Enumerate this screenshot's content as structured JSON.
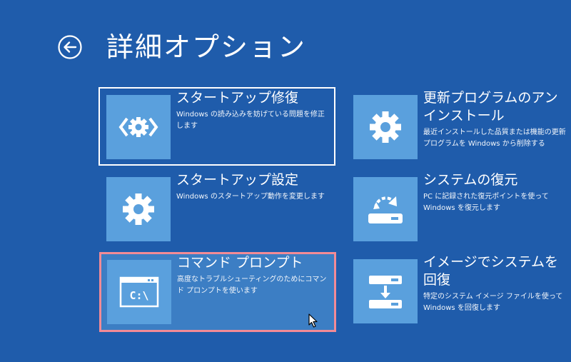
{
  "header": {
    "title": "詳細オプション",
    "back_icon": "back-arrow-icon"
  },
  "options": [
    {
      "title": "スタートアップ修復",
      "desc": "Windows の読み込みを妨げている問題を修正します",
      "icon": "startup-repair-icon"
    },
    {
      "title": "スタートアップ設定",
      "desc": "Windows のスタートアップ動作を変更します",
      "icon": "gear-icon"
    },
    {
      "title": "コマンド プロンプト",
      "desc": "高度なトラブルシューティングのためにコマンド プロンプトを使います",
      "icon": "command-prompt-icon"
    },
    {
      "title": "更新プログラムのアンインストール",
      "desc": "最近インストールした品質または機能の更新プログラムを Windows から削除する",
      "icon": "gear-icon"
    },
    {
      "title": "システムの復元",
      "desc": "PC に記録された復元ポイントを使って Windows を復元します",
      "icon": "system-restore-icon"
    },
    {
      "title": "イメージでシステムを回復",
      "desc": "特定のシステム イメージ ファイルを使って Windows を回復します",
      "icon": "system-image-recovery-icon"
    }
  ],
  "colors": {
    "background": "#1f5cab",
    "tile_icon_bg": "#5aa0dd",
    "focus_border": "#ffffff",
    "highlight_border": "#f28b96"
  },
  "prompt_glyph": "C:\\"
}
